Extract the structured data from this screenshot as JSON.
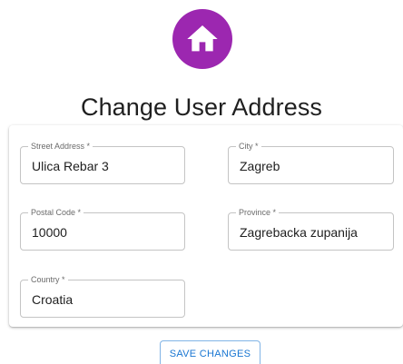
{
  "header": {
    "avatar_icon": "home-icon",
    "avatar_color": "#9c27b0",
    "title": "Change User Address"
  },
  "form": {
    "street_address": {
      "label": "Street Address *",
      "value": "Ulica Rebar 3"
    },
    "city": {
      "label": "City *",
      "value": "Zagreb"
    },
    "postal_code": {
      "label": "Postal Code *",
      "value": "10000"
    },
    "province": {
      "label": "Province *",
      "value": "Zagrebacka zupanija"
    },
    "country": {
      "label": "Country *",
      "value": "Croatia"
    }
  },
  "actions": {
    "save_label": "SAVE CHANGES",
    "accent_color": "#1976d2"
  }
}
